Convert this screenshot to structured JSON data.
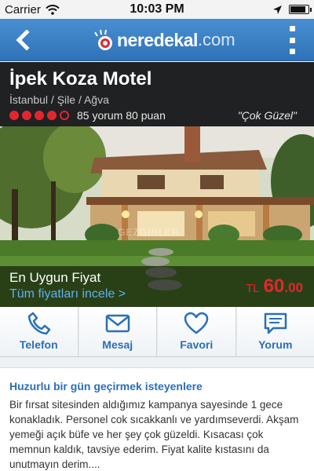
{
  "status_bar": {
    "carrier": "Carrier",
    "time": "10:03 PM",
    "battery_level": 0.9
  },
  "header": {
    "logo_name": "neredekal",
    "logo_tld": ".com",
    "back_icon": "chevron-left-icon",
    "menu_icon": "vertical-dots-icon"
  },
  "hotel": {
    "name": "İpek Koza Motel",
    "location": "İstanbul / Şile / Ağva",
    "rating_dots_filled": 4,
    "rating_dots_total": 5,
    "rating_text": "85 yorum 80 puan",
    "quote": "\"Çok Güzel\""
  },
  "photo": {
    "watermark": "GEZGINLER"
  },
  "price": {
    "label": "En Uygun Fiyat",
    "link": "Tüm fiyatları incele >",
    "currency": "TL",
    "amount_int": "60",
    "amount_dec": ".00"
  },
  "actions": [
    {
      "label": "Telefon",
      "icon": "phone-icon"
    },
    {
      "label": "Mesaj",
      "icon": "envelope-icon"
    },
    {
      "label": "Favori",
      "icon": "heart-icon"
    },
    {
      "label": "Yorum",
      "icon": "speech-bubble-icon"
    }
  ],
  "review": {
    "title": "Huzurlu bir gün geçirmek isteyenlere",
    "body": "Bir fırsat sitesinden aldığımız kampanya sayesinde 1 gece konakladık. Personel cok sıcakkanlı ve yardımseverdi. Akşam yemeği açık büfe ve her şey çok güzeldi. Kısacası çok memnun kaldık, tavsiye ederim. Fiyat kalite kıstasını da unutmayın derim...."
  },
  "colors": {
    "brand_blue": "#2f72b8",
    "accent_red": "#e3262e",
    "link_blue": "#5fb0ef"
  }
}
